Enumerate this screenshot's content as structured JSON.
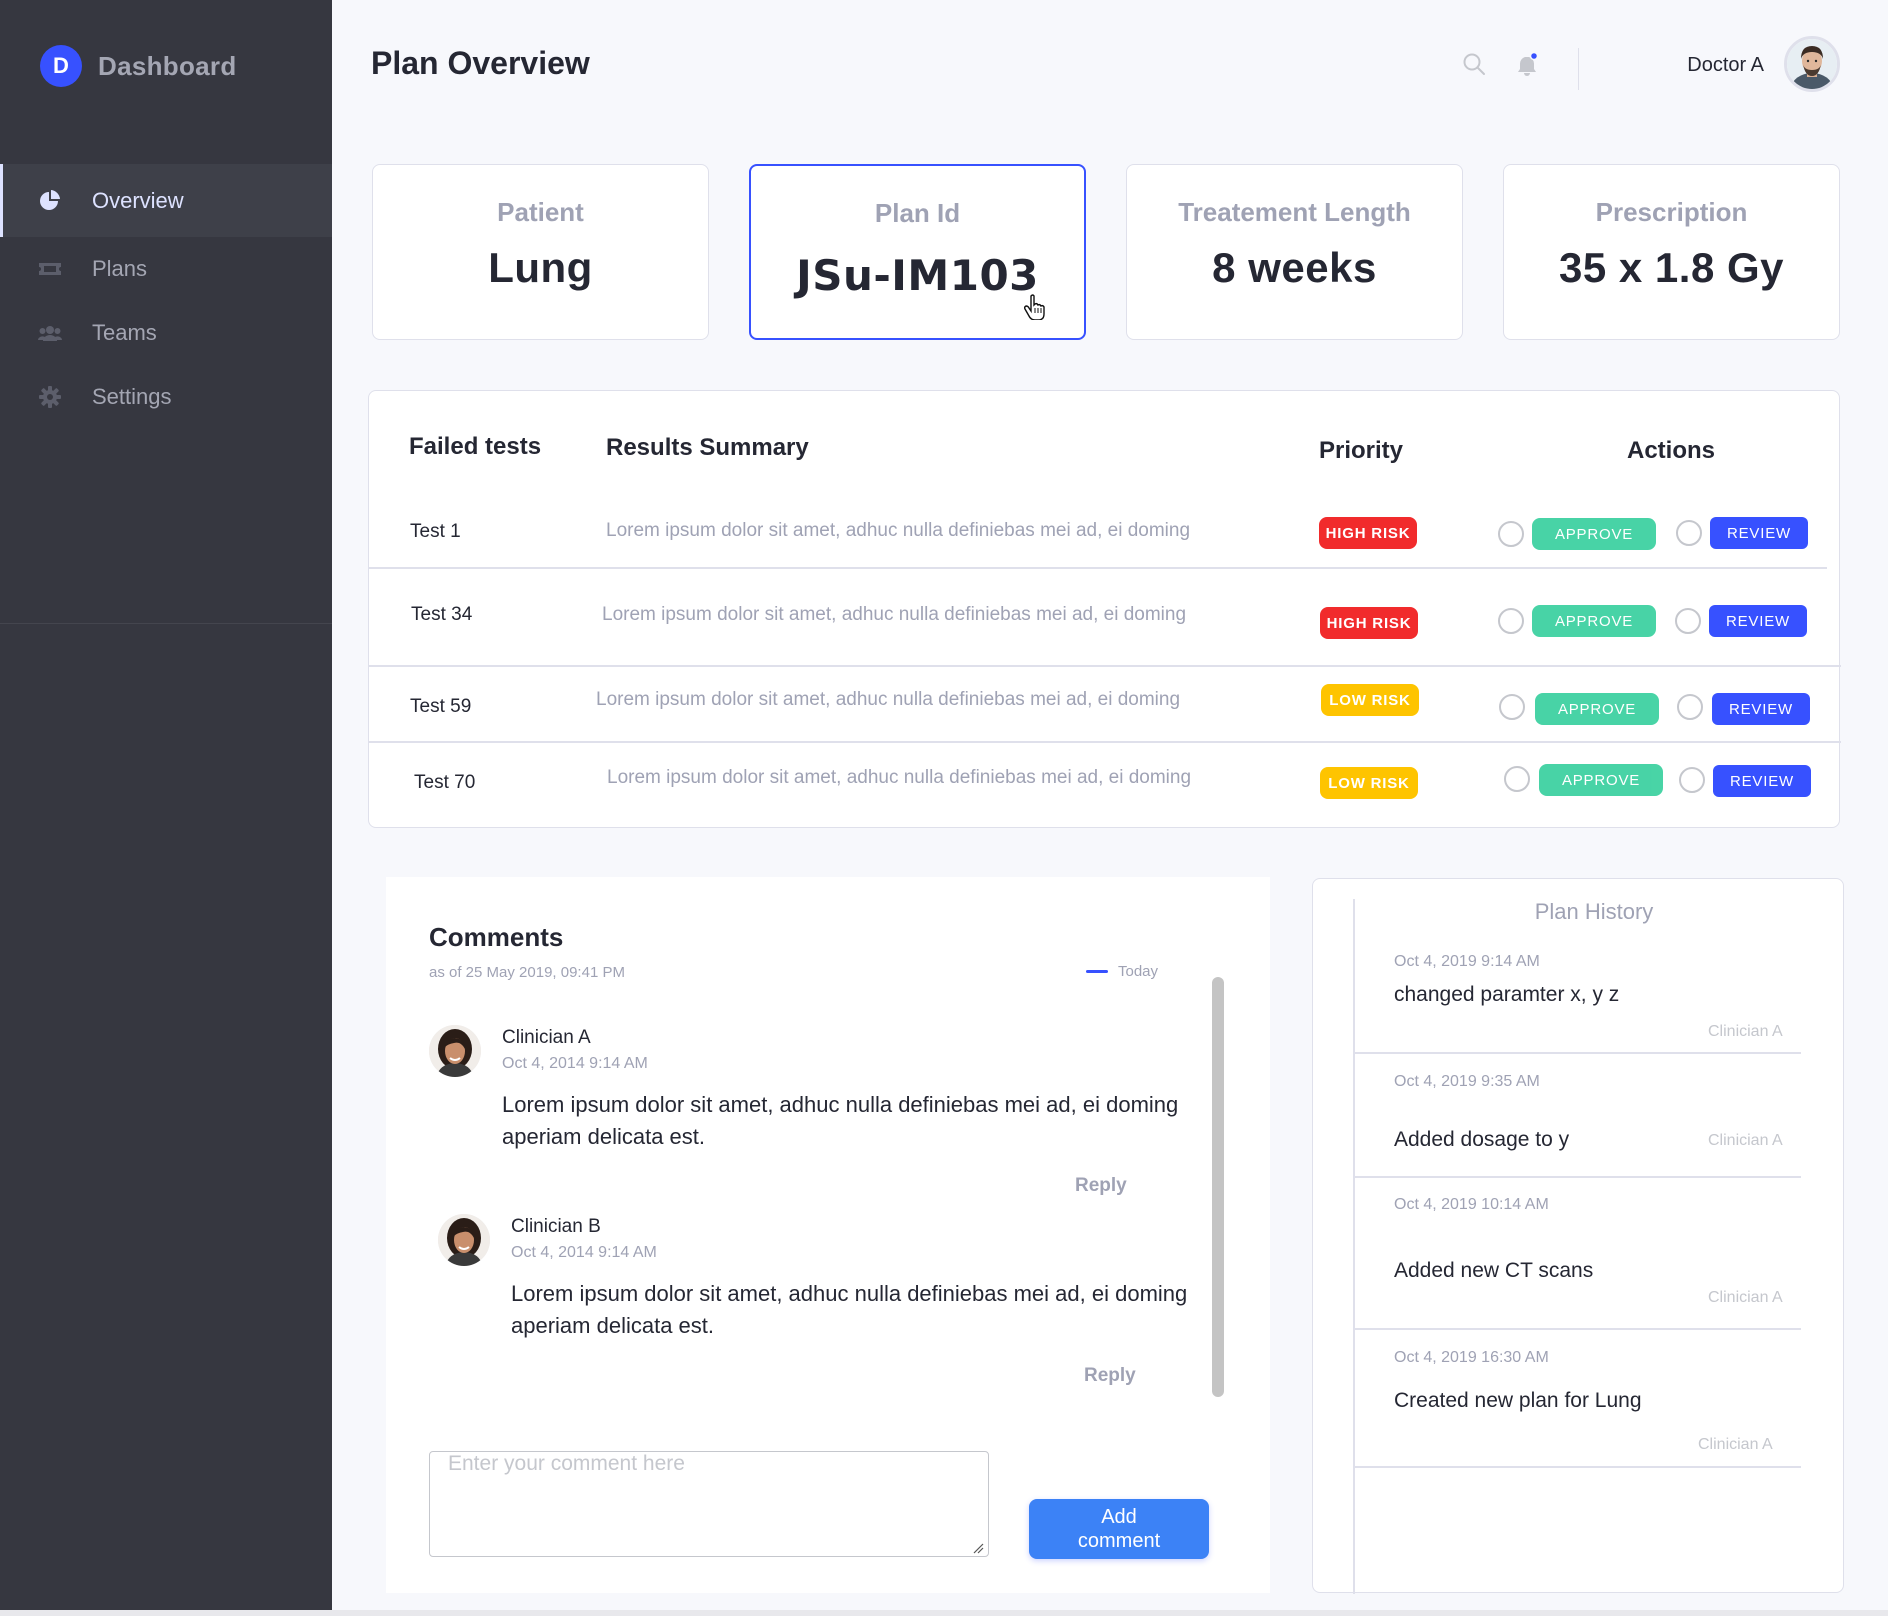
{
  "brand": {
    "logo_letter": "D",
    "name": "Dashboard",
    "accent": "#3751ff"
  },
  "sidebar": {
    "items": [
      {
        "label": "Overview",
        "icon": "pie-chart-icon",
        "active": true
      },
      {
        "label": "Plans",
        "icon": "ticket-icon"
      },
      {
        "label": "Teams",
        "icon": "users-icon"
      },
      {
        "label": "Settings",
        "icon": "gear-icon"
      }
    ]
  },
  "header": {
    "title": "Plan Overview",
    "user_name": "Doctor A",
    "icons": [
      "search-icon",
      "bell-icon"
    ]
  },
  "stats": [
    {
      "label": "Patient",
      "value": "Lung"
    },
    {
      "label": "Plan Id",
      "value": "JSu-IM103"
    },
    {
      "label": "Treatement Length",
      "value": "8 weeks"
    },
    {
      "label": "Prescription",
      "value": "35 x 1.8 Gy"
    }
  ],
  "tests": {
    "headers": {
      "name": "Failed tests",
      "summary": "Results Summary",
      "priority": "Priority",
      "actions": "Actions"
    },
    "approve_label": "APPROVE",
    "review_label": "REVIEW",
    "rows": [
      {
        "name": "Test 1",
        "summary": "Lorem ipsum dolor sit amet, adhuc nulla definiebas mei ad, ei doming",
        "priority": "HIGH RISK"
      },
      {
        "name": "Test 34",
        "summary": "Lorem ipsum dolor sit amet, adhuc nulla definiebas mei ad, ei doming",
        "priority": "HIGH RISK"
      },
      {
        "name": "Test 59",
        "summary": "Lorem ipsum dolor sit amet, adhuc nulla definiebas mei ad, ei doming",
        "priority": "LOW RISK"
      },
      {
        "name": "Test 70",
        "summary": "Lorem ipsum dolor sit amet, adhuc nulla definiebas mei ad, ei doming",
        "priority": "LOW RISK"
      }
    ],
    "colors": {
      "high": "#f12b2c",
      "low": "#fec400",
      "approve": "#29cc97",
      "review": "#3751ff"
    }
  },
  "comments": {
    "title": "Comments",
    "subtitle": "as of 25 May 2019, 09:41 PM",
    "legend": "Today",
    "items": [
      {
        "author": "Clinician A",
        "date": "Oct 4, 2014 9:14 AM",
        "body": "Lorem ipsum dolor sit amet, adhuc nulla definiebas mei ad, ei doming aperiam delicata est.",
        "reply": "Reply"
      },
      {
        "author": "Clinician B",
        "date": "Oct 4, 2014 9:14 AM",
        "body": "Lorem ipsum dolor sit amet, adhuc nulla definiebas mei ad, ei doming aperiam delicata est.",
        "reply": "Reply"
      }
    ],
    "input_placeholder": "Enter your comment here",
    "input_value": "",
    "add_button": "Add comment"
  },
  "history": {
    "title": "Plan History",
    "entries": [
      {
        "date": "Oct 4, 2019 9:14 AM",
        "text": "changed paramter x, y z",
        "by": "Clinician A"
      },
      {
        "date": "Oct 4, 2019 9:35 AM",
        "text": "Added dosage to y",
        "by": "Clinician A"
      },
      {
        "date": "Oct 4, 2019 10:14 AM",
        "text": "Added new CT scans",
        "by": "Clinician A"
      },
      {
        "date": "Oct 4, 2019 16:30 AM",
        "text": "Created new plan for Lung",
        "by": "Clinician A"
      }
    ]
  }
}
